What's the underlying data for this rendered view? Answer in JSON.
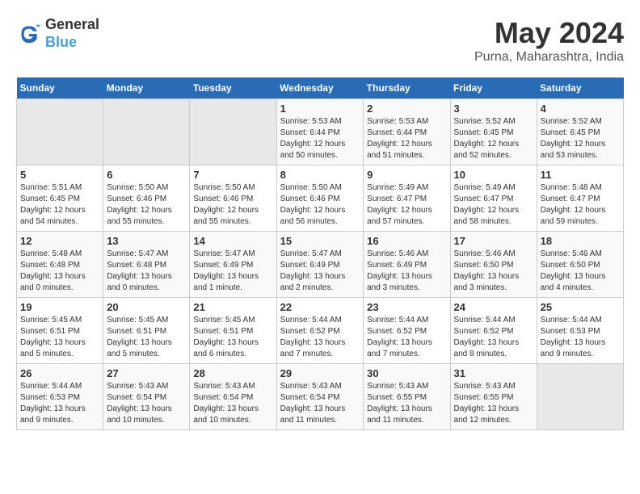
{
  "header": {
    "logo_line1": "General",
    "logo_line2": "Blue",
    "month": "May 2024",
    "location": "Purna, Maharashtra, India"
  },
  "weekdays": [
    "Sunday",
    "Monday",
    "Tuesday",
    "Wednesday",
    "Thursday",
    "Friday",
    "Saturday"
  ],
  "weeks": [
    [
      {
        "day": "",
        "info": ""
      },
      {
        "day": "",
        "info": ""
      },
      {
        "day": "",
        "info": ""
      },
      {
        "day": "1",
        "info": "Sunrise: 5:53 AM\nSunset: 6:44 PM\nDaylight: 12 hours\nand 50 minutes."
      },
      {
        "day": "2",
        "info": "Sunrise: 5:53 AM\nSunset: 6:44 PM\nDaylight: 12 hours\nand 51 minutes."
      },
      {
        "day": "3",
        "info": "Sunrise: 5:52 AM\nSunset: 6:45 PM\nDaylight: 12 hours\nand 52 minutes."
      },
      {
        "day": "4",
        "info": "Sunrise: 5:52 AM\nSunset: 6:45 PM\nDaylight: 12 hours\nand 53 minutes."
      }
    ],
    [
      {
        "day": "5",
        "info": "Sunrise: 5:51 AM\nSunset: 6:45 PM\nDaylight: 12 hours\nand 54 minutes."
      },
      {
        "day": "6",
        "info": "Sunrise: 5:50 AM\nSunset: 6:46 PM\nDaylight: 12 hours\nand 55 minutes."
      },
      {
        "day": "7",
        "info": "Sunrise: 5:50 AM\nSunset: 6:46 PM\nDaylight: 12 hours\nand 55 minutes."
      },
      {
        "day": "8",
        "info": "Sunrise: 5:50 AM\nSunset: 6:46 PM\nDaylight: 12 hours\nand 56 minutes."
      },
      {
        "day": "9",
        "info": "Sunrise: 5:49 AM\nSunset: 6:47 PM\nDaylight: 12 hours\nand 57 minutes."
      },
      {
        "day": "10",
        "info": "Sunrise: 5:49 AM\nSunset: 6:47 PM\nDaylight: 12 hours\nand 58 minutes."
      },
      {
        "day": "11",
        "info": "Sunrise: 5:48 AM\nSunset: 6:47 PM\nDaylight: 12 hours\nand 59 minutes."
      }
    ],
    [
      {
        "day": "12",
        "info": "Sunrise: 5:48 AM\nSunset: 6:48 PM\nDaylight: 13 hours\nand 0 minutes."
      },
      {
        "day": "13",
        "info": "Sunrise: 5:47 AM\nSunset: 6:48 PM\nDaylight: 13 hours\nand 0 minutes."
      },
      {
        "day": "14",
        "info": "Sunrise: 5:47 AM\nSunset: 6:49 PM\nDaylight: 13 hours\nand 1 minute."
      },
      {
        "day": "15",
        "info": "Sunrise: 5:47 AM\nSunset: 6:49 PM\nDaylight: 13 hours\nand 2 minutes."
      },
      {
        "day": "16",
        "info": "Sunrise: 5:46 AM\nSunset: 6:49 PM\nDaylight: 13 hours\nand 3 minutes."
      },
      {
        "day": "17",
        "info": "Sunrise: 5:46 AM\nSunset: 6:50 PM\nDaylight: 13 hours\nand 3 minutes."
      },
      {
        "day": "18",
        "info": "Sunrise: 5:46 AM\nSunset: 6:50 PM\nDaylight: 13 hours\nand 4 minutes."
      }
    ],
    [
      {
        "day": "19",
        "info": "Sunrise: 5:45 AM\nSunset: 6:51 PM\nDaylight: 13 hours\nand 5 minutes."
      },
      {
        "day": "20",
        "info": "Sunrise: 5:45 AM\nSunset: 6:51 PM\nDaylight: 13 hours\nand 5 minutes."
      },
      {
        "day": "21",
        "info": "Sunrise: 5:45 AM\nSunset: 6:51 PM\nDaylight: 13 hours\nand 6 minutes."
      },
      {
        "day": "22",
        "info": "Sunrise: 5:44 AM\nSunset: 6:52 PM\nDaylight: 13 hours\nand 7 minutes."
      },
      {
        "day": "23",
        "info": "Sunrise: 5:44 AM\nSunset: 6:52 PM\nDaylight: 13 hours\nand 7 minutes."
      },
      {
        "day": "24",
        "info": "Sunrise: 5:44 AM\nSunset: 6:52 PM\nDaylight: 13 hours\nand 8 minutes."
      },
      {
        "day": "25",
        "info": "Sunrise: 5:44 AM\nSunset: 6:53 PM\nDaylight: 13 hours\nand 9 minutes."
      }
    ],
    [
      {
        "day": "26",
        "info": "Sunrise: 5:44 AM\nSunset: 6:53 PM\nDaylight: 13 hours\nand 9 minutes."
      },
      {
        "day": "27",
        "info": "Sunrise: 5:43 AM\nSunset: 6:54 PM\nDaylight: 13 hours\nand 10 minutes."
      },
      {
        "day": "28",
        "info": "Sunrise: 5:43 AM\nSunset: 6:54 PM\nDaylight: 13 hours\nand 10 minutes."
      },
      {
        "day": "29",
        "info": "Sunrise: 5:43 AM\nSunset: 6:54 PM\nDaylight: 13 hours\nand 11 minutes."
      },
      {
        "day": "30",
        "info": "Sunrise: 5:43 AM\nSunset: 6:55 PM\nDaylight: 13 hours\nand 11 minutes."
      },
      {
        "day": "31",
        "info": "Sunrise: 5:43 AM\nSunset: 6:55 PM\nDaylight: 13 hours\nand 12 minutes."
      },
      {
        "day": "",
        "info": ""
      }
    ]
  ]
}
